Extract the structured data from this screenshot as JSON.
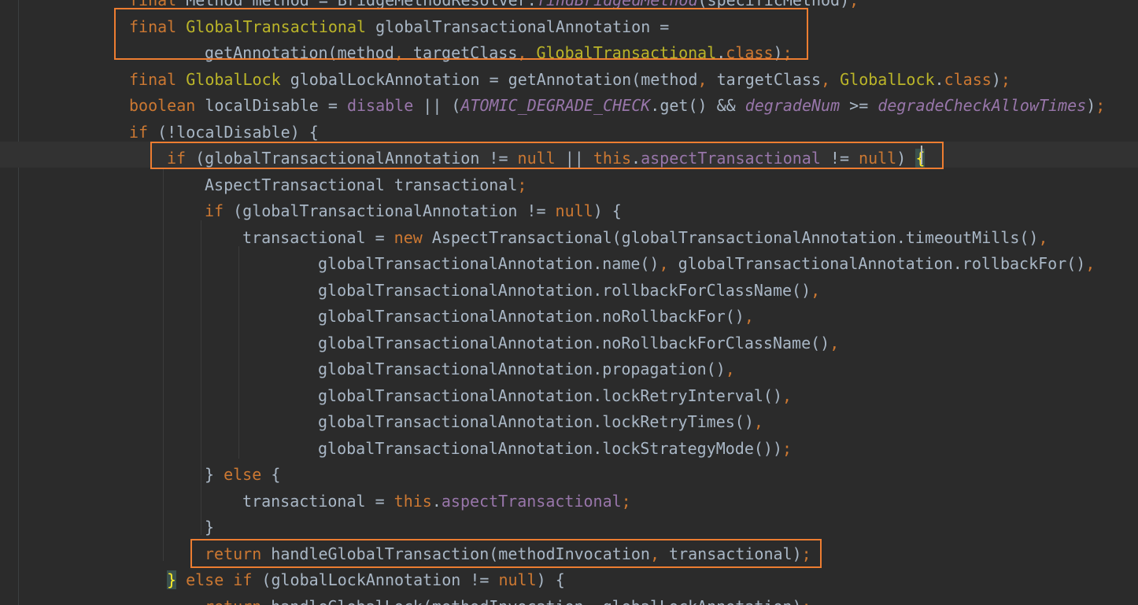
{
  "editor": {
    "colors": {
      "background": "#2b2b2b",
      "keyword": "#cc7832",
      "annotation_type": "#bbb529",
      "field": "#9876aa",
      "plain": "#a9b7c6",
      "highlight_box": "#ed7d31"
    },
    "lines": [
      [
        {
          "c": "kw",
          "t": "final "
        },
        {
          "c": "",
          "t": "Method method = BridgeMethodResolver."
        },
        {
          "c": "stat",
          "t": "findBridgedMethod"
        },
        {
          "c": "",
          "t": "(specificMethod)"
        },
        {
          "c": "kw",
          "t": ";"
        }
      ],
      [
        {
          "c": "kw",
          "t": "final "
        },
        {
          "c": "ann",
          "t": "GlobalTransactional"
        },
        {
          "c": "",
          "t": " globalTransactionalAnnotation ="
        }
      ],
      [
        {
          "c": "",
          "t": "getAnnotation(method"
        },
        {
          "c": "kw",
          "t": ", "
        },
        {
          "c": "",
          "t": "targetClass"
        },
        {
          "c": "kw",
          "t": ", "
        },
        {
          "c": "ann",
          "t": "GlobalTransactional"
        },
        {
          "c": "",
          "t": "."
        },
        {
          "c": "kw",
          "t": "class"
        },
        {
          "c": "",
          "t": ")"
        },
        {
          "c": "kw",
          "t": ";"
        }
      ],
      [
        {
          "c": "kw",
          "t": "final "
        },
        {
          "c": "ann",
          "t": "GlobalLock"
        },
        {
          "c": "",
          "t": " globalLockAnnotation = getAnnotation(method"
        },
        {
          "c": "kw",
          "t": ", "
        },
        {
          "c": "",
          "t": "targetClass"
        },
        {
          "c": "kw",
          "t": ", "
        },
        {
          "c": "ann",
          "t": "GlobalLock"
        },
        {
          "c": "",
          "t": "."
        },
        {
          "c": "kw",
          "t": "class"
        },
        {
          "c": "",
          "t": ")"
        },
        {
          "c": "kw",
          "t": ";"
        }
      ],
      [
        {
          "c": "kw",
          "t": "boolean "
        },
        {
          "c": "",
          "t": "localDisable = "
        },
        {
          "c": "fld",
          "t": "disable"
        },
        {
          "c": "",
          "t": " || ("
        },
        {
          "c": "stat",
          "t": "ATOMIC_DEGRADE_CHECK"
        },
        {
          "c": "",
          "t": ".get() && "
        },
        {
          "c": "stat",
          "t": "degradeNum"
        },
        {
          "c": "",
          "t": " >= "
        },
        {
          "c": "stat",
          "t": "degradeCheckAllowTimes"
        },
        {
          "c": "",
          "t": ")"
        },
        {
          "c": "kw",
          "t": ";"
        }
      ],
      [
        {
          "c": "kw",
          "t": "if "
        },
        {
          "c": "",
          "t": "(!localDisable) {"
        }
      ],
      [
        {
          "c": "kw",
          "t": "if "
        },
        {
          "c": "",
          "t": "(globalTransactionalAnnotation != "
        },
        {
          "c": "kw",
          "t": "null"
        },
        {
          "c": "",
          "t": " || "
        },
        {
          "c": "kw",
          "t": "this"
        },
        {
          "c": "",
          "t": "."
        },
        {
          "c": "fld",
          "t": "aspectTransactional"
        },
        {
          "c": "",
          "t": " != "
        },
        {
          "c": "kw",
          "t": "null"
        },
        {
          "c": "",
          "t": ") "
        },
        {
          "c": "brace-hl",
          "t": "{"
        }
      ],
      [
        {
          "c": "",
          "t": "AspectTransactional transactional"
        },
        {
          "c": "kw",
          "t": ";"
        }
      ],
      [
        {
          "c": "kw",
          "t": "if "
        },
        {
          "c": "",
          "t": "(globalTransactionalAnnotation != "
        },
        {
          "c": "kw",
          "t": "null"
        },
        {
          "c": "",
          "t": ") {"
        }
      ],
      [
        {
          "c": "",
          "t": "transactional = "
        },
        {
          "c": "kw",
          "t": "new "
        },
        {
          "c": "",
          "t": "AspectTransactional(globalTransactionalAnnotation.timeoutMills()"
        },
        {
          "c": "kw",
          "t": ","
        }
      ],
      [
        {
          "c": "",
          "t": "globalTransactionalAnnotation.name()"
        },
        {
          "c": "kw",
          "t": ", "
        },
        {
          "c": "",
          "t": "globalTransactionalAnnotation.rollbackFor()"
        },
        {
          "c": "kw",
          "t": ","
        }
      ],
      [
        {
          "c": "",
          "t": "globalTransactionalAnnotation.rollbackForClassName()"
        },
        {
          "c": "kw",
          "t": ","
        }
      ],
      [
        {
          "c": "",
          "t": "globalTransactionalAnnotation.noRollbackFor()"
        },
        {
          "c": "kw",
          "t": ","
        }
      ],
      [
        {
          "c": "",
          "t": "globalTransactionalAnnotation.noRollbackForClassName()"
        },
        {
          "c": "kw",
          "t": ","
        }
      ],
      [
        {
          "c": "",
          "t": "globalTransactionalAnnotation.propagation()"
        },
        {
          "c": "kw",
          "t": ","
        }
      ],
      [
        {
          "c": "",
          "t": "globalTransactionalAnnotation.lockRetryInterval()"
        },
        {
          "c": "kw",
          "t": ","
        }
      ],
      [
        {
          "c": "",
          "t": "globalTransactionalAnnotation.lockRetryTimes()"
        },
        {
          "c": "kw",
          "t": ","
        }
      ],
      [
        {
          "c": "",
          "t": "globalTransactionalAnnotation.lockStrategyMode())"
        },
        {
          "c": "kw",
          "t": ";"
        }
      ],
      [
        {
          "c": "",
          "t": "} "
        },
        {
          "c": "kw",
          "t": "else "
        },
        {
          "c": "",
          "t": "{"
        }
      ],
      [
        {
          "c": "",
          "t": "transactional = "
        },
        {
          "c": "kw",
          "t": "this"
        },
        {
          "c": "",
          "t": "."
        },
        {
          "c": "fld",
          "t": "aspectTransactional"
        },
        {
          "c": "kw",
          "t": ";"
        }
      ],
      [
        {
          "c": "",
          "t": "}"
        }
      ],
      [
        {
          "c": "kw",
          "t": "return "
        },
        {
          "c": "",
          "t": "handleGlobalTransaction(methodInvocation"
        },
        {
          "c": "kw",
          "t": ", "
        },
        {
          "c": "",
          "t": "transactional)"
        },
        {
          "c": "kw",
          "t": ";"
        }
      ],
      [
        {
          "c": "brace-hl",
          "t": "}"
        },
        {
          "c": "",
          "t": " "
        },
        {
          "c": "kw",
          "t": "else if "
        },
        {
          "c": "",
          "t": "(globalLockAnnotation != "
        },
        {
          "c": "kw",
          "t": "null"
        },
        {
          "c": "",
          "t": ") {"
        }
      ],
      [
        {
          "c": "kw",
          "t": "return "
        },
        {
          "c": "",
          "t": "handleGlobalLock(methodInvocation"
        },
        {
          "c": "kw",
          "t": ", "
        },
        {
          "c": "",
          "t": "globalLockAnnotation)"
        },
        {
          "c": "kw",
          "t": ";"
        }
      ]
    ]
  }
}
